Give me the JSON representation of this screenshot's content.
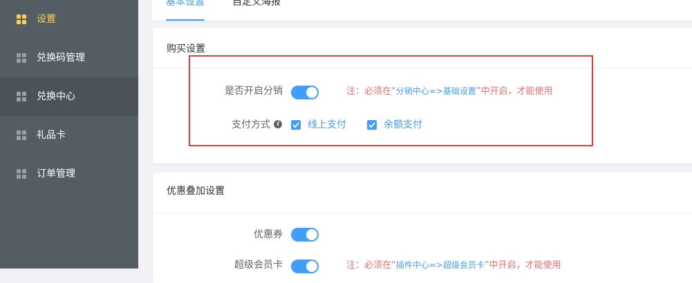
{
  "sidebar": {
    "items": [
      {
        "label": "设置",
        "icon": "grid-icon",
        "active": true
      },
      {
        "label": "兑换码管理",
        "icon": "grid-icon"
      },
      {
        "label": "兑换中心",
        "icon": "grid-icon"
      },
      {
        "label": "礼品卡",
        "icon": "grid-icon"
      },
      {
        "label": "订单管理",
        "icon": "grid-icon"
      }
    ]
  },
  "tabs": [
    {
      "label": "基本设置",
      "active": true
    },
    {
      "label": "自定义海报"
    }
  ],
  "purchase": {
    "title": "购买设置",
    "distribution_label": "是否开启分销",
    "distribution_on": true,
    "note_prefix": "注：必须在“",
    "note_link": "分销中心=>基础设置",
    "note_suffix": "”中开启，才能使用",
    "payment_label": "支付方式",
    "payment_options": [
      {
        "label": "线上支付",
        "checked": true
      },
      {
        "label": "余额支付",
        "checked": true
      }
    ]
  },
  "discount": {
    "title": "优惠叠加设置",
    "coupon_label": "优惠券",
    "coupon_on": true,
    "vip_label": "超级会员卡",
    "vip_on": true,
    "note_prefix": "注：必须在“",
    "note_link": "插件中心=>超级会员卡",
    "note_suffix": "”中开启，才能使用"
  },
  "colors": {
    "primary": "#409eff",
    "warning_note": "#f56c6c",
    "sidebar_bg": "#545c64",
    "sidebar_active": "#ffd04b",
    "highlight": "#e53935"
  }
}
